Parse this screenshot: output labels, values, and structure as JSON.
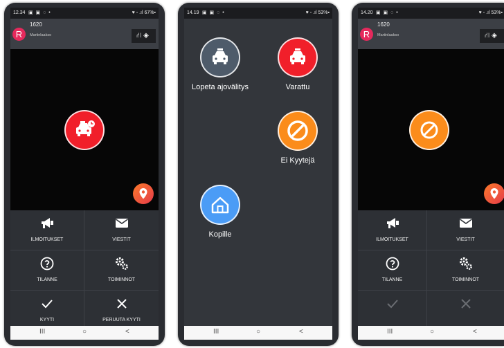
{
  "screen1": {
    "status": {
      "time": "12.34",
      "left_icons": "▣ ▣ ◌ •",
      "right": "♥ ◦ .ıl 67%▪"
    },
    "avatar_letter": "R",
    "unit": "1620",
    "area": "Martinlaakso",
    "buttons": [
      {
        "label": "ILMOITUKSET",
        "icon": "megaphone-icon"
      },
      {
        "label": "VIESTIT",
        "icon": "envelope-icon"
      },
      {
        "label": "TILANNE",
        "icon": "question-icon"
      },
      {
        "label": "TOIMINNOT",
        "icon": "gears-icon"
      },
      {
        "label": "KYYTI",
        "icon": "check-icon"
      },
      {
        "label": "PERUUTA KYYTI",
        "icon": "close-icon"
      }
    ]
  },
  "screen2": {
    "status": {
      "time": "14.19",
      "left_icons": "▣ ▣ ◌ •",
      "right": "♥ ◦ .ıl 53%▪"
    },
    "actions": [
      {
        "label": "Lopeta ajovälitys",
        "color": "#4e5b6a"
      },
      {
        "label": "Varattu",
        "color": "#f11f2a"
      },
      {
        "label": "Ei Kyytejä",
        "color": "#fb8c1b"
      },
      {
        "label": "Kopille",
        "color": "#4b9cf6"
      }
    ]
  },
  "screen3": {
    "status": {
      "time": "14.20",
      "left_icons": "▣ ▣ ◌ •",
      "right": "♥ ◦ .ıl 53%▪"
    },
    "avatar_letter": "R",
    "unit": "1620",
    "area": "Martinlaakso",
    "buttons": [
      {
        "label": "ILMOITUKSET"
      },
      {
        "label": "VIESTIT"
      },
      {
        "label": "TILANNE"
      },
      {
        "label": "TOIMINNOT"
      }
    ]
  },
  "navbar": {
    "recents": "III",
    "home": "○",
    "back": "<"
  },
  "colors": {
    "accent_red": "#f11f2a",
    "accent_orange": "#fb8c1b",
    "avatar": "#e5295c",
    "panel": "#2d3035"
  }
}
